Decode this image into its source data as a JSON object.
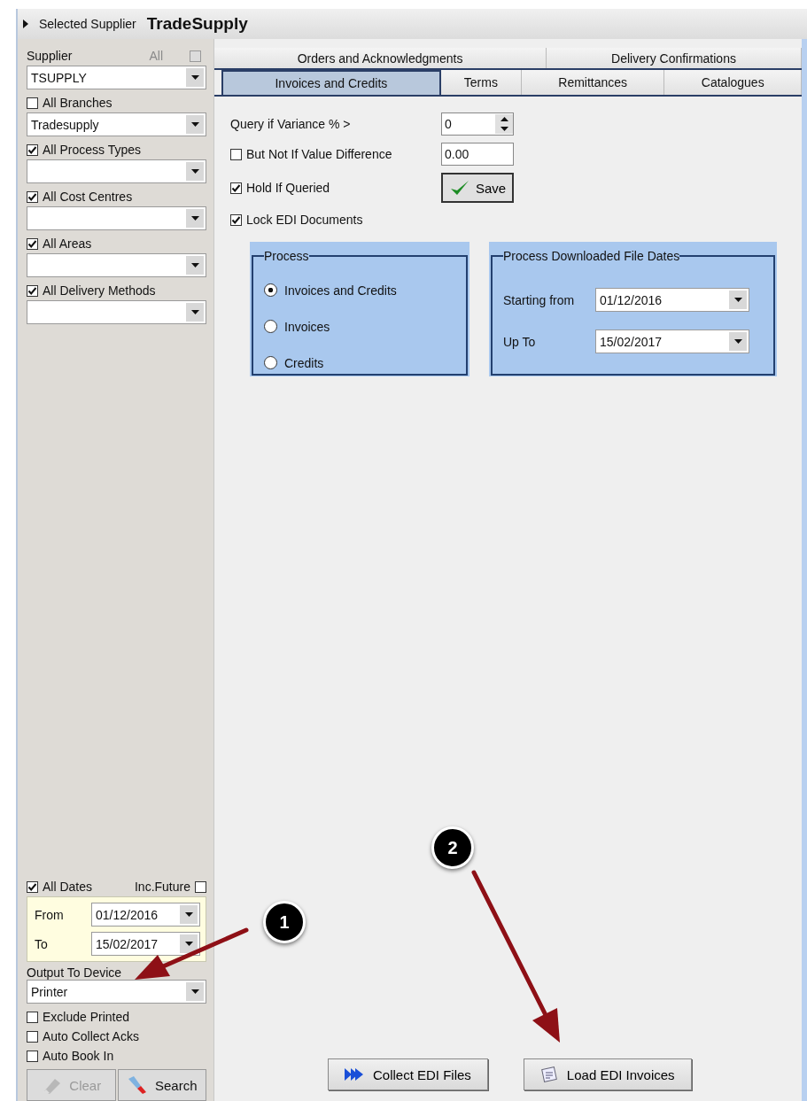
{
  "header": {
    "label": "Selected Supplier",
    "value": "TradeSupply"
  },
  "supplier": {
    "label": "Supplier",
    "all_label": "All",
    "all_checked": false,
    "value": "TSUPPLY"
  },
  "filters": [
    {
      "label": "All Branches",
      "checked": false,
      "value": "Tradesupply"
    },
    {
      "label": "All Process Types",
      "checked": true
    },
    {
      "label": "All Cost Centres",
      "checked": true
    },
    {
      "label": "All Areas",
      "checked": true
    },
    {
      "label": "All Delivery Methods",
      "checked": true
    }
  ],
  "dates": {
    "all_dates": {
      "label": "All Dates",
      "checked": true
    },
    "inc_future": {
      "label": "Inc.Future",
      "checked": false
    },
    "from": {
      "label": "From",
      "value": "01/12/2016"
    },
    "to": {
      "label": "To",
      "value": "15/02/2017"
    }
  },
  "output": {
    "label": "Output To Device",
    "value": "Printer"
  },
  "options": [
    {
      "label": "Exclude Printed",
      "checked": false
    },
    {
      "label": "Auto Collect Acks",
      "checked": false
    },
    {
      "label": "Auto Book In",
      "checked": false
    }
  ],
  "actions": [
    {
      "label": "Clear",
      "disabled": true
    },
    {
      "label": "Search",
      "disabled": false
    }
  ],
  "tab_rows": [
    [
      {
        "label": "Orders and Acknowledgments",
        "selected": false
      },
      {
        "label": "Delivery Confirmations",
        "selected": false
      }
    ],
    [
      {
        "label": "Invoices and Credits",
        "selected": true
      },
      {
        "label": "Terms",
        "selected": false
      },
      {
        "label": "Remittances",
        "selected": false
      },
      {
        "label": "Catalogues",
        "selected": false
      }
    ]
  ],
  "settings": {
    "variance": {
      "label": "Query if Variance % >",
      "value": "0"
    },
    "value_difference": {
      "label": "But Not If Value Difference",
      "checked": false,
      "value": "0.00"
    },
    "hold": {
      "label": "Hold If Queried",
      "checked": true
    },
    "lock": {
      "label": "Lock EDI Documents",
      "checked": true
    },
    "save": "Save"
  },
  "process": {
    "title": "Process",
    "options": [
      {
        "label": "Invoices and Credits",
        "selected": true
      },
      {
        "label": "Invoices",
        "selected": false
      },
      {
        "label": "Credits",
        "selected": false
      }
    ]
  },
  "file_dates": {
    "title": "Process Downloaded File Dates",
    "start": {
      "label": "Starting from",
      "value": "01/12/2016"
    },
    "end": {
      "label": "Up To",
      "value": "15/02/2017"
    }
  },
  "buttons": [
    {
      "label": "Collect EDI Files"
    },
    {
      "label": "Load EDI Invoices"
    }
  ],
  "callouts": [
    {
      "number": "1"
    },
    {
      "number": "2"
    }
  ]
}
